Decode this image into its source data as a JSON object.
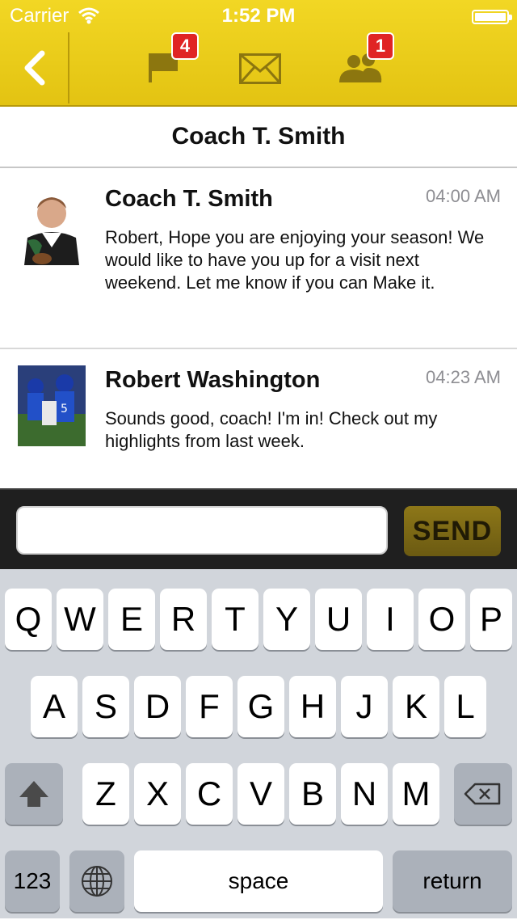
{
  "status_bar": {
    "carrier": "Carrier",
    "time": "1:52 PM"
  },
  "nav": {
    "notifications_badge": "4",
    "friends_badge": "1"
  },
  "conversation": {
    "title": "Coach T. Smith"
  },
  "messages": [
    {
      "sender": "Coach T. Smith",
      "time": "04:00 AM",
      "text": "Robert, Hope you are enjoying your season! We would like to have you up for a visit next weekend. Let me know if you can Make it."
    },
    {
      "sender": "Robert Washington",
      "time": "04:23 AM",
      "text": "Sounds good, coach! I'm in! Check out my highlights from last week."
    }
  ],
  "composer": {
    "value": "",
    "send_label": "SEND"
  },
  "keyboard": {
    "row1": [
      "Q",
      "W",
      "E",
      "R",
      "T",
      "Y",
      "U",
      "I",
      "O",
      "P"
    ],
    "row2": [
      "A",
      "S",
      "D",
      "F",
      "G",
      "H",
      "J",
      "K",
      "L"
    ],
    "row3": [
      "Z",
      "X",
      "C",
      "V",
      "B",
      "N",
      "M"
    ],
    "numbers_label": "123",
    "space_label": "space",
    "return_label": "return"
  }
}
